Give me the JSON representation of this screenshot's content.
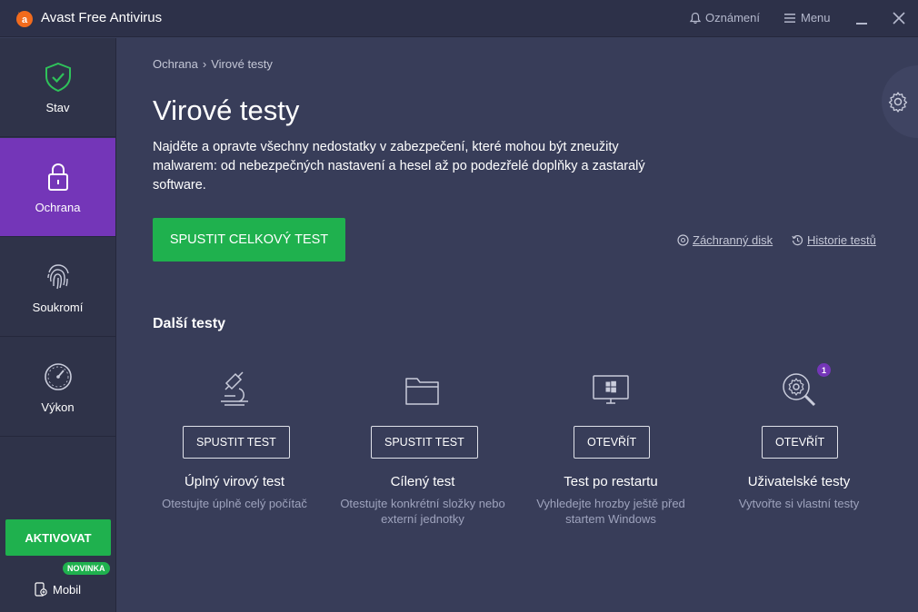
{
  "app": {
    "title": "Avast Free Antivirus"
  },
  "titlebar": {
    "notifications": "Oznámení",
    "menu": "Menu"
  },
  "sidebar": {
    "items": [
      {
        "label": "Stav",
        "icon": "shield-check-icon"
      },
      {
        "label": "Ochrana",
        "icon": "lock-icon",
        "active": true
      },
      {
        "label": "Soukromí",
        "icon": "fingerprint-icon"
      },
      {
        "label": "Výkon",
        "icon": "speedometer-icon"
      }
    ],
    "activate_label": "AKTIVOVAT",
    "new_badge": "NOVINKA",
    "mobile_label": "Mobil"
  },
  "breadcrumb": {
    "parent": "Ochrana",
    "separator": "›",
    "current": "Virové testy"
  },
  "main": {
    "title": "Virové testy",
    "description": "Najděte a opravte všechny nedostatky v zabezpečení, které mohou být zneužity malwarem: od nebezpečných nastavení a hesel až po podezřelé doplňky a zastaralý software.",
    "primary_button": "SPUSTIT CELKOVÝ TEST",
    "links": {
      "rescue_disk": "Záchranný disk",
      "history": "Historie testů"
    },
    "section_title": "Další testy"
  },
  "cards": [
    {
      "icon": "microscope-icon",
      "button": "SPUSTIT TEST",
      "title": "Úplný virový test",
      "desc": "Otestujte úplně celý počítač"
    },
    {
      "icon": "folder-icon",
      "button": "SPUSTIT TEST",
      "title": "Cílený test",
      "desc": "Otestujte konkrétní složky nebo externí jednotky"
    },
    {
      "icon": "windows-monitor-icon",
      "button": "OTEVŘÍT",
      "title": "Test po restartu",
      "desc": "Vyhledejte hrozby ještě před startem Windows"
    },
    {
      "icon": "gear-search-icon",
      "button": "OTEVŘÍT",
      "title": "Uživatelské testy",
      "desc": "Vytvořte si vlastní testy",
      "badge": "1"
    }
  ],
  "colors": {
    "accent_green": "#1fb14e",
    "accent_purple": "#7436b8",
    "background": "#383d59",
    "sidebar": "#2f3349"
  }
}
